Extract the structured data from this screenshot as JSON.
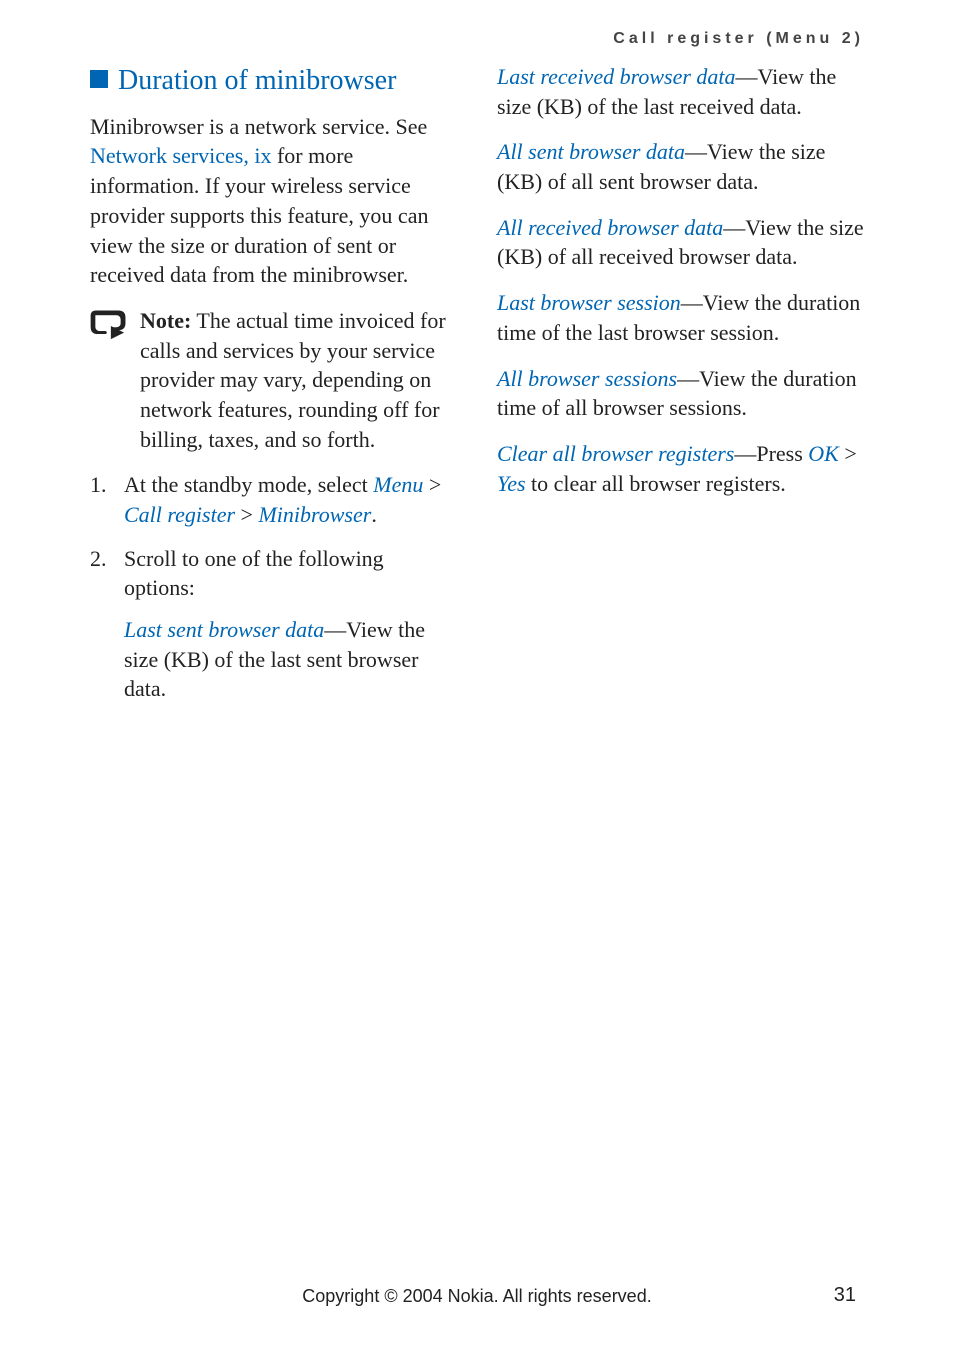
{
  "runningHeader": "Call register (Menu 2)",
  "heading": "Duration of minibrowser",
  "intro_pre": "Minibrowser is a network service. See ",
  "intro_link": "Network services, ix",
  "intro_post": " for more information. If your wireless service provider supports this feature, you can view the size or duration of sent or received data from the minibrowser.",
  "note_label": "Note:",
  "note_body": " The actual time invoiced for calls and services by your service provider may vary, depending on network features, rounding off for billing, taxes, and so forth.",
  "step1_num": "1.",
  "step1_pre": "At the standby mode, select ",
  "step1_menu": "Menu",
  "step1_gt1": " > ",
  "step1_call": "Call register",
  "step1_gt2": " > ",
  "step1_mini": "Minibrowser",
  "step1_post": ".",
  "step2_num": "2.",
  "step2_text": "Scroll to one of the following options:",
  "opts": {
    "lastSent": {
      "label": "Last sent browser data",
      "desc": "—View the size (KB) of the last sent browser data."
    },
    "lastRecv": {
      "label": "Last received browser data",
      "desc": "—View the size (KB) of the last received data."
    },
    "allSent": {
      "label": "All sent browser data",
      "desc": "—View the size (KB) of all sent browser data."
    },
    "allRecv": {
      "label": "All received browser data",
      "desc": "—View the size (KB) of all received browser data."
    },
    "lastSession": {
      "label": "Last browser session",
      "desc": "—View the duration time of the last browser session."
    },
    "allSessions": {
      "label": "All browser sessions",
      "desc": "—View the duration time of all browser sessions."
    },
    "clear": {
      "label": "Clear all browser registers",
      "pre": "—Press ",
      "ok": "OK",
      "gt": " > ",
      "yes": "Yes",
      "post": " to clear all browser registers."
    }
  },
  "copyright": "Copyright © 2004 Nokia. All rights reserved.",
  "pageNumber": "31"
}
